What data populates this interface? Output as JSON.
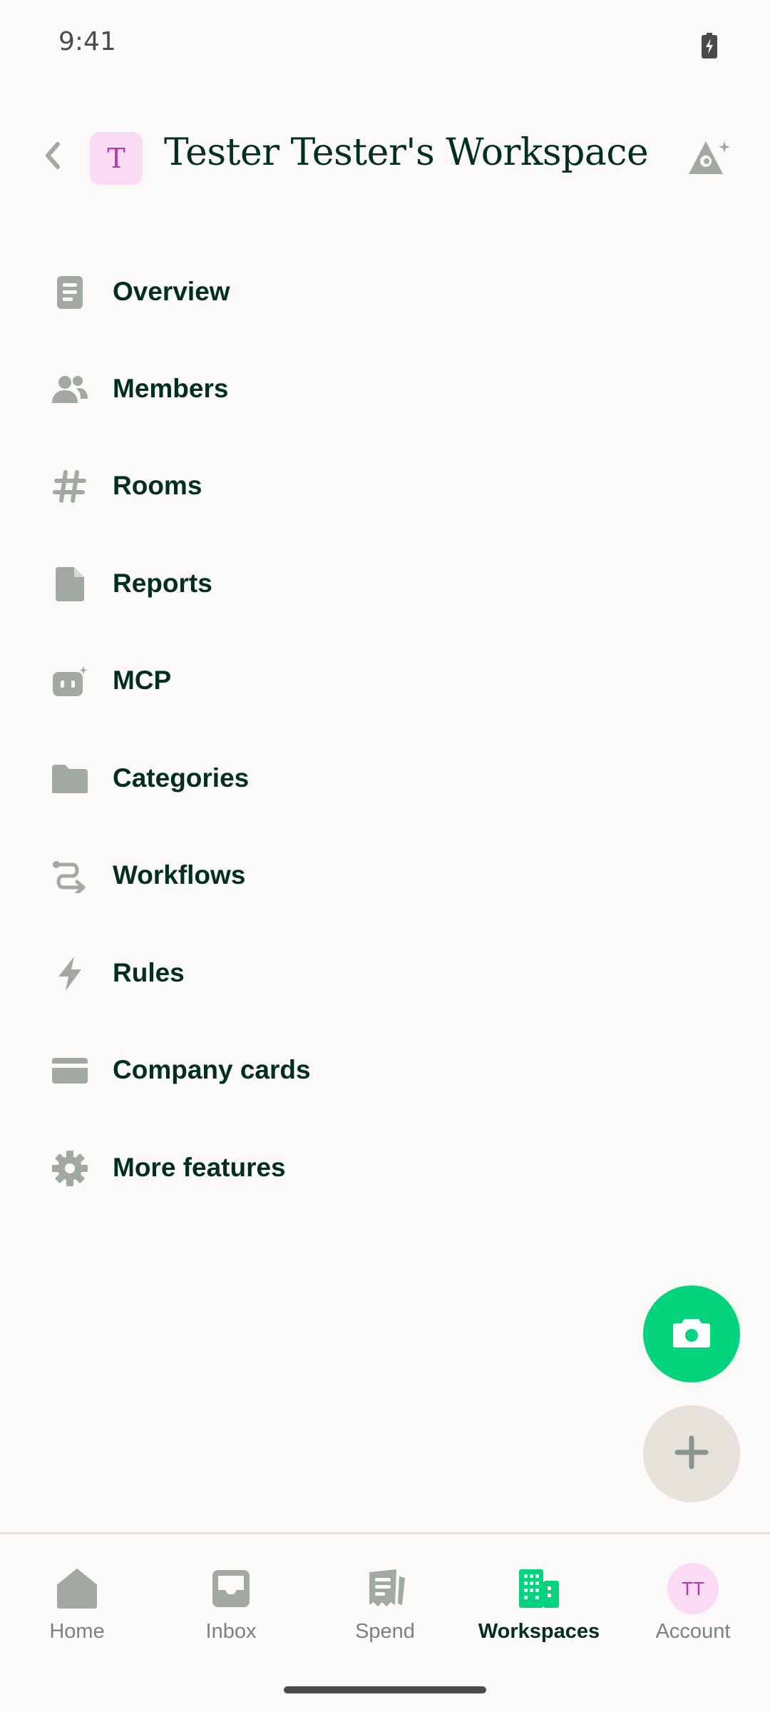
{
  "status_bar": {
    "time": "9:41"
  },
  "header": {
    "avatar_letter": "T",
    "title": "Tester Tester's Workspace"
  },
  "menu": {
    "items": [
      {
        "label": "Overview",
        "icon": "document-icon"
      },
      {
        "label": "Members",
        "icon": "users-icon"
      },
      {
        "label": "Rooms",
        "icon": "hashtag-icon"
      },
      {
        "label": "Reports",
        "icon": "file-icon"
      },
      {
        "label": "MCP",
        "icon": "robot-icon"
      },
      {
        "label": "Categories",
        "icon": "folder-icon"
      },
      {
        "label": "Workflows",
        "icon": "workflow-icon"
      },
      {
        "label": "Rules",
        "icon": "lightning-icon"
      },
      {
        "label": "Company cards",
        "icon": "credit-card-icon"
      },
      {
        "label": "More features",
        "icon": "gear-icon"
      }
    ]
  },
  "bottom_nav": {
    "tabs": [
      {
        "label": "Home",
        "icon": "home-icon",
        "active": false
      },
      {
        "label": "Inbox",
        "icon": "inbox-icon",
        "active": false
      },
      {
        "label": "Spend",
        "icon": "receipt-icon",
        "active": false
      },
      {
        "label": "Workspaces",
        "icon": "building-icon",
        "active": true
      },
      {
        "label": "Account",
        "icon": "avatar",
        "active": false
      }
    ],
    "account_initials": "TT"
  },
  "colors": {
    "background": "#FBFAF8",
    "text_primary": "#002E22",
    "icon_muted": "#A2A9A3",
    "accent_green": "#03D47C",
    "avatar_bg": "#FBDAF4",
    "avatar_text": "#B337B3"
  }
}
